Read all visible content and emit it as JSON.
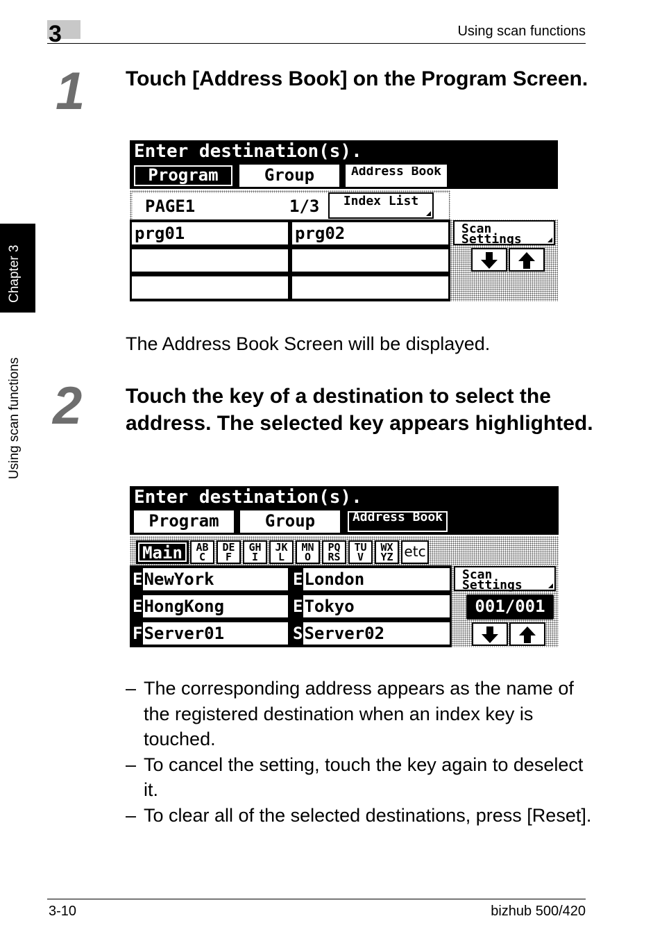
{
  "header": {
    "chapter_number": "3",
    "running_title": "Using scan functions"
  },
  "side_tabs": {
    "chapter": "Chapter 3",
    "section": "Using scan functions"
  },
  "step1": {
    "number": "1",
    "title": "Touch [Address Book] on the Program Screen.",
    "result": "The Address Book Screen will be displayed."
  },
  "screen1": {
    "title": "Enter destination(s).",
    "tabs": {
      "program": "Program",
      "group": "Group",
      "address_book": "Address Book"
    },
    "page_label": "PAGE1",
    "page_count": "1/3",
    "index_list": "Index List",
    "programs": [
      "prg01",
      "prg02",
      "",
      "",
      "",
      ""
    ],
    "scan_settings": "Scan Settings"
  },
  "step2": {
    "number": "2",
    "title": "Touch the key of a destination to select the address. The selected key appears highlighted."
  },
  "screen2": {
    "title": "Enter destination(s).",
    "tabs": {
      "program": "Program",
      "group": "Group",
      "address_book": "Address Book"
    },
    "index_keys": [
      "Main",
      "AB C",
      "DE F",
      "GH I",
      "JK L",
      "MN O",
      "PQ RS",
      "TU V",
      "WX YZ",
      "etc"
    ],
    "destinations": [
      {
        "type": "E",
        "name": "NewYork"
      },
      {
        "type": "E",
        "name": "London"
      },
      {
        "type": "E",
        "name": "HongKong"
      },
      {
        "type": "E",
        "name": "Tokyo"
      },
      {
        "type": "F",
        "name": "Server01"
      },
      {
        "type": "S",
        "name": "Server02"
      }
    ],
    "scan_settings": "Scan Settings",
    "page_counter": "001/001"
  },
  "notes": [
    "The corresponding address appears as the name of the registered destination when an index key is touched.",
    "To cancel the setting, touch the key again to deselect it.",
    "To clear all of the selected destinations, press [Reset]."
  ],
  "footer": {
    "page_number": "3-10",
    "product": "bizhub 500/420"
  }
}
